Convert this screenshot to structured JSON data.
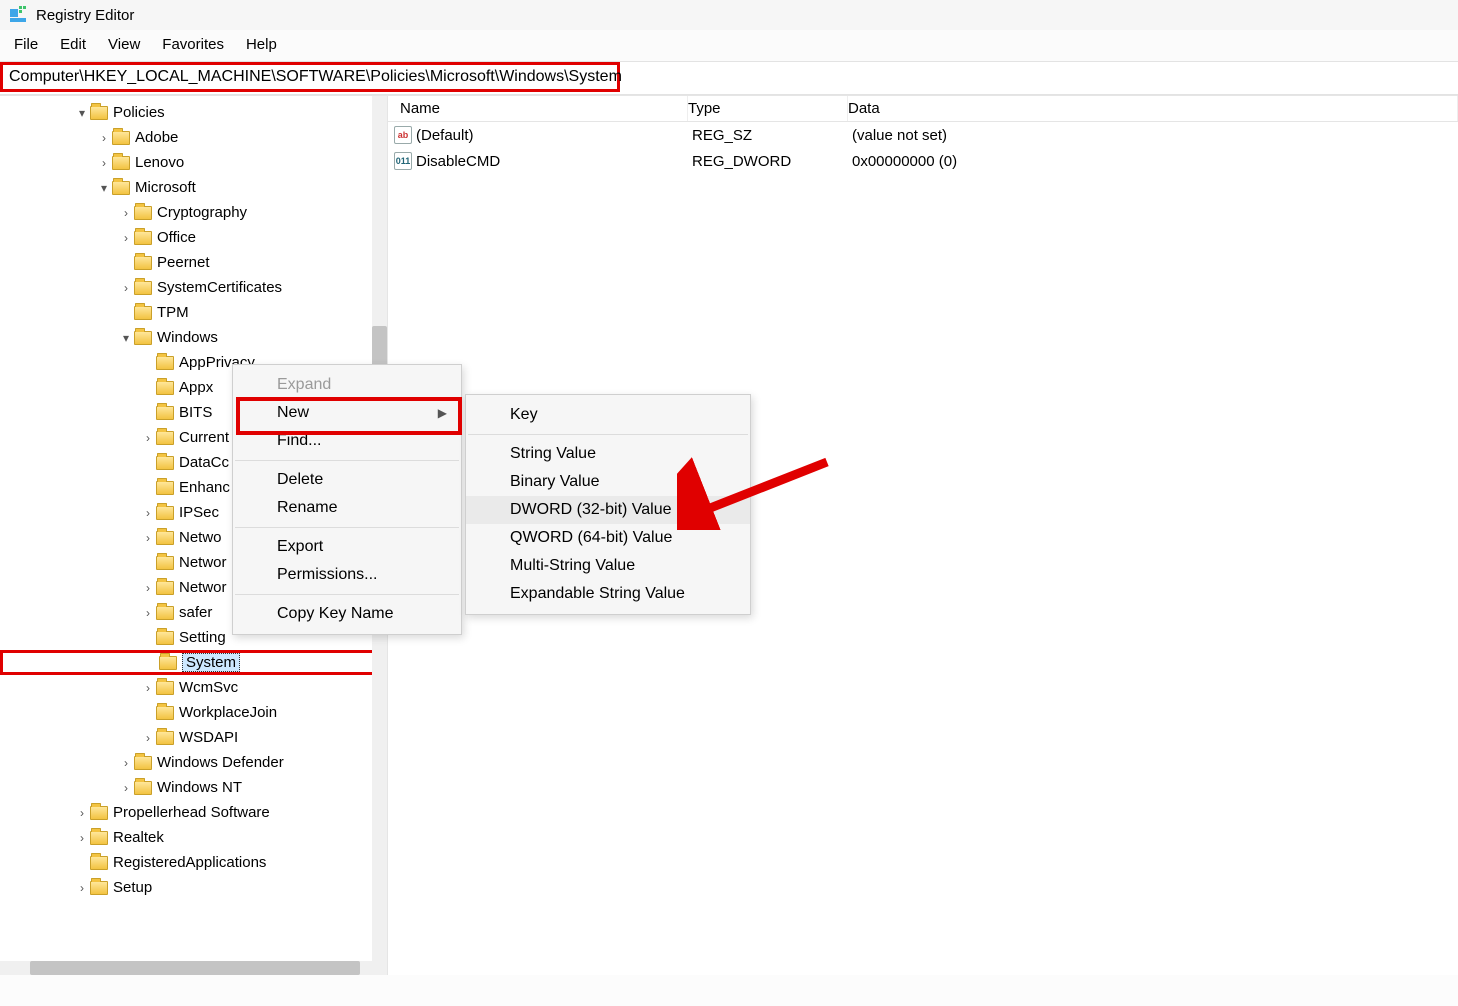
{
  "window": {
    "title": "Registry Editor"
  },
  "menu": {
    "file": "File",
    "edit": "Edit",
    "view": "View",
    "favorites": "Favorites",
    "help": "Help"
  },
  "address": {
    "path": "Computer\\HKEY_LOCAL_MACHINE\\SOFTWARE\\Policies\\Microsoft\\Windows\\System"
  },
  "tree": {
    "policies": "Policies",
    "adobe": "Adobe",
    "lenovo": "Lenovo",
    "microsoft": "Microsoft",
    "cryptography": "Cryptography",
    "office": "Office",
    "peernet": "Peernet",
    "systemcerts": "SystemCertificates",
    "tpm": "TPM",
    "windowsKey": "Windows",
    "appprivacy": "AppPrivacy",
    "appx": "Appx",
    "bits": "BITS",
    "current": "Current",
    "datacc": "DataCc",
    "enhanc": "Enhanc",
    "ipsec": "IPSec",
    "netwo1": "Netwo",
    "netwo2": "Networ",
    "networ3": "Networ",
    "safer": "safer",
    "setting": "Setting",
    "system": "System",
    "wcmsvc": "WcmSvc",
    "workplacejoin": "WorkplaceJoin",
    "wsdapi": "WSDAPI",
    "windefender": "Windows Defender",
    "winnt": "Windows NT",
    "propellerhead": "Propellerhead Software",
    "realtek": "Realtek",
    "regapps": "RegisteredApplications",
    "setup": "Setup"
  },
  "columns": {
    "name": "Name",
    "type": "Type",
    "data": "Data"
  },
  "values": [
    {
      "name": "(Default)",
      "type": "REG_SZ",
      "data": "(value not set)",
      "icon": "ab"
    },
    {
      "name": "DisableCMD",
      "type": "REG_DWORD",
      "data": "0x00000000 (0)",
      "icon": "num"
    }
  ],
  "ctx1": {
    "expand": "Expand",
    "new": "New",
    "find": "Find...",
    "delete": "Delete",
    "rename": "Rename",
    "export": "Export",
    "permissions": "Permissions...",
    "copykeyname": "Copy Key Name"
  },
  "ctx2": {
    "key": "Key",
    "string": "String Value",
    "binary": "Binary Value",
    "dword": "DWORD (32-bit) Value",
    "qword": "QWORD (64-bit) Value",
    "multistring": "Multi-String Value",
    "expandable": "Expandable String Value"
  }
}
